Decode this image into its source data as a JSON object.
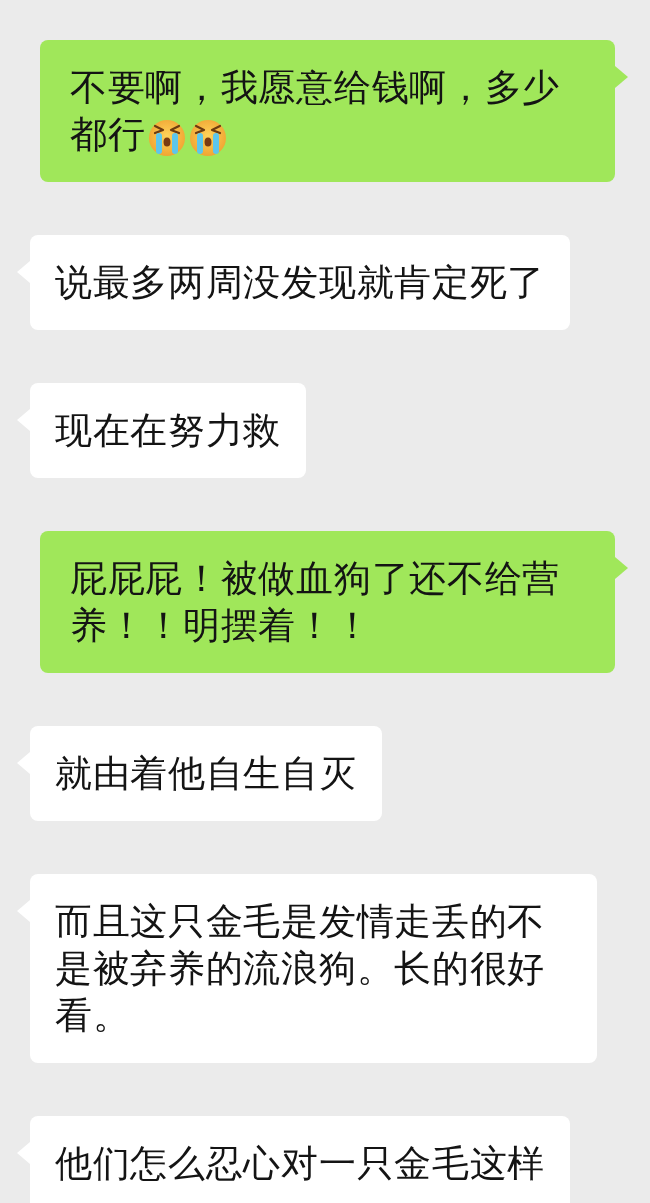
{
  "messages": [
    {
      "kind": "sent",
      "lines": [
        "不要啊，我愿意给钱啊，多少",
        "都行"
      ],
      "emojis": [
        {
          "kind": "crying"
        },
        {
          "kind": "crying"
        }
      ]
    },
    {
      "kind": "received",
      "lines": [
        "说最多两周没发现就肯定死了"
      ]
    },
    {
      "kind": "received",
      "lines": [
        "现在在努力救"
      ]
    },
    {
      "kind": "sent",
      "lines": [
        "屁屁屁！被做血狗了还不给营养！！明摆着！！"
      ]
    },
    {
      "kind": "received",
      "lines": [
        "就由着他自生自灭"
      ]
    },
    {
      "kind": "received",
      "lines": [
        "而且这只金毛是发情走丢的不是被弃养的流浪狗。长的很好看。"
      ]
    },
    {
      "kind": "received",
      "lines": [
        "他们怎么忍心对一只金毛这样"
      ]
    }
  ]
}
